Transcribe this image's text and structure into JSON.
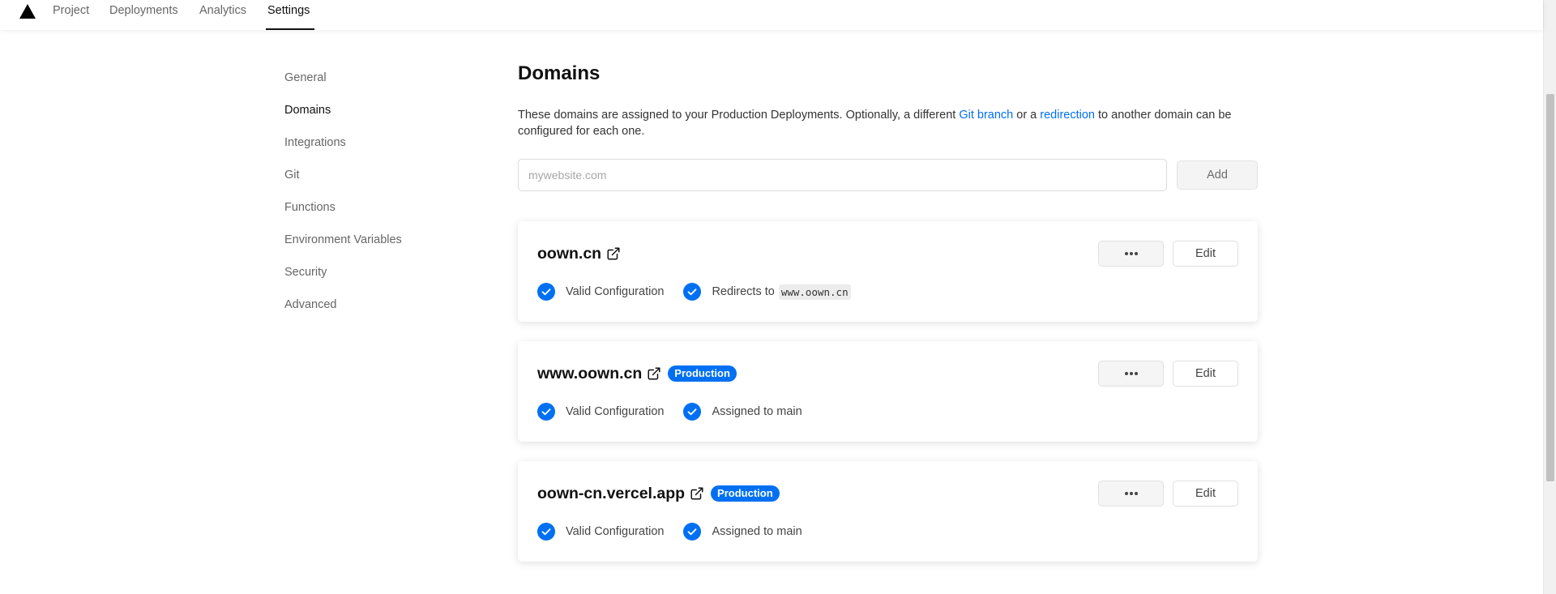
{
  "nav": {
    "tabs": [
      {
        "label": "Project"
      },
      {
        "label": "Deployments"
      },
      {
        "label": "Analytics"
      },
      {
        "label": "Settings",
        "active": true
      }
    ]
  },
  "sidebar": {
    "items": [
      {
        "label": "General"
      },
      {
        "label": "Domains",
        "active": true
      },
      {
        "label": "Integrations"
      },
      {
        "label": "Git"
      },
      {
        "label": "Functions"
      },
      {
        "label": "Environment Variables"
      },
      {
        "label": "Security"
      },
      {
        "label": "Advanced"
      }
    ]
  },
  "main": {
    "title": "Domains",
    "description": {
      "part1": "These domains are assigned to your Production Deployments. Optionally, a different ",
      "link1": "Git branch",
      "part2": " or a ",
      "link2": "redirection",
      "part3": " to another domain can be configured for each one."
    },
    "input": {
      "placeholder": "mywebsite.com",
      "value": ""
    },
    "add_label": "Add"
  },
  "domains": [
    {
      "name": "oown.cn",
      "badge": "",
      "edit_label": "Edit",
      "status1": "Valid Configuration",
      "status2_prefix": "Redirects to",
      "status2_code": "www.oown.cn"
    },
    {
      "name": "www.oown.cn",
      "badge": "Production",
      "edit_label": "Edit",
      "status1": "Valid Configuration",
      "status2": "Assigned to main"
    },
    {
      "name": "oown-cn.vercel.app",
      "badge": "Production",
      "edit_label": "Edit",
      "status1": "Valid Configuration",
      "status2": "Assigned to main"
    }
  ],
  "icons": {
    "logo": "triangle-logo-icon",
    "external": "external-link-icon",
    "check": "check-circle-icon",
    "more": "more-dots-icon"
  },
  "colors": {
    "accent": "#0070f3",
    "text": "#111111",
    "muted": "#666666"
  }
}
